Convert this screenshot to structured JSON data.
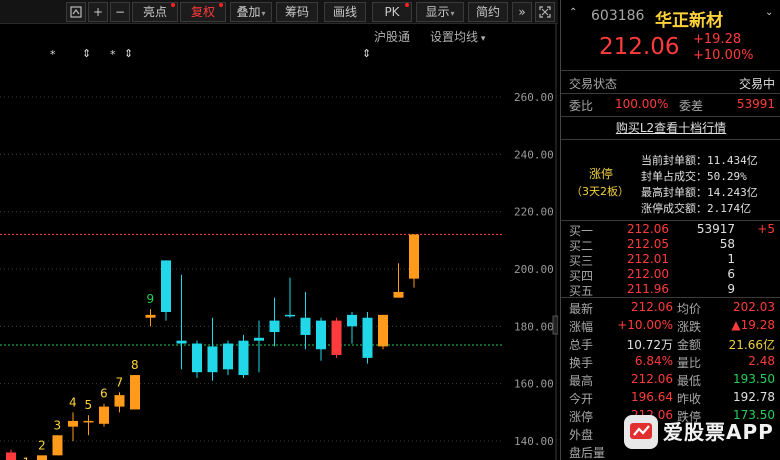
{
  "toolbar": {
    "items": [
      "亮点",
      "复权",
      "叠加",
      "筹码",
      "画线",
      "PK",
      "显示",
      "简约"
    ],
    "icons": [
      "resize-icon",
      "plus-icon",
      "minus-icon",
      "double-chevron-right-icon",
      "fullscreen-icon"
    ]
  },
  "chart_header": {
    "link1": "沪股通",
    "link2": "设置均线",
    "markers": [
      "*",
      "⇕",
      "*",
      "⇕",
      "⇕"
    ]
  },
  "chart_data": {
    "type": "candlestick",
    "y_ticks": [
      "260.00",
      "240.00",
      "220.00",
      "200.00",
      "180.00",
      "160.00",
      "140.00"
    ],
    "ylim": [
      128,
      270
    ],
    "reference_lines": [
      {
        "value": 212.06,
        "color": "#ff4040"
      },
      {
        "value": 173.5,
        "color": "#25d05a"
      }
    ],
    "candles": [
      {
        "o": 136,
        "c": 132,
        "h": 137,
        "l": 128,
        "up": false
      },
      {
        "o": 128,
        "c": 128,
        "h": 129,
        "l": 127,
        "up": true,
        "label": "1"
      },
      {
        "o": 128,
        "c": 135,
        "h": 135,
        "l": 128,
        "up": true,
        "label": "2"
      },
      {
        "o": 135,
        "c": 142,
        "h": 142,
        "l": 135,
        "up": true,
        "label": "3"
      },
      {
        "o": 145,
        "c": 147,
        "h": 150,
        "l": 140,
        "up": true,
        "label": "4"
      },
      {
        "o": 147,
        "c": 147,
        "h": 149,
        "l": 142,
        "up": true,
        "label": "5"
      },
      {
        "o": 146,
        "c": 152,
        "h": 153,
        "l": 145,
        "up": true,
        "label": "6"
      },
      {
        "o": 152,
        "c": 156,
        "h": 157,
        "l": 150,
        "up": true,
        "label": "7"
      },
      {
        "o": 151,
        "c": 163,
        "h": 163,
        "l": 151,
        "up": true,
        "label": "8"
      },
      {
        "o": 183,
        "c": 184,
        "h": 186,
        "l": 180,
        "up": true,
        "label": "9"
      },
      {
        "o": 203,
        "c": 185,
        "h": 203,
        "l": 182,
        "up": false
      },
      {
        "o": 175,
        "c": 174,
        "h": 198,
        "l": 165,
        "up": false
      },
      {
        "o": 174,
        "c": 164,
        "h": 175,
        "l": 162,
        "up": false
      },
      {
        "o": 173,
        "c": 164,
        "h": 183,
        "l": 161,
        "up": false
      },
      {
        "o": 174,
        "c": 165,
        "h": 175,
        "l": 163,
        "up": false
      },
      {
        "o": 175,
        "c": 163,
        "h": 177,
        "l": 162,
        "up": false
      },
      {
        "o": 176,
        "c": 175,
        "h": 182,
        "l": 164,
        "up": false
      },
      {
        "o": 182,
        "c": 178,
        "h": 190,
        "l": 173,
        "up": false
      },
      {
        "o": 184,
        "c": 184,
        "h": 197,
        "l": 183,
        "up": false
      },
      {
        "o": 183,
        "c": 177,
        "h": 192,
        "l": 172,
        "up": false
      },
      {
        "o": 182,
        "c": 172,
        "h": 183,
        "l": 168,
        "up": false
      },
      {
        "o": 170,
        "c": 182,
        "h": 183,
        "l": 169,
        "up": true
      },
      {
        "o": 184,
        "c": 180,
        "h": 185,
        "l": 174,
        "up": false
      },
      {
        "o": 183,
        "c": 169,
        "h": 185,
        "l": 167,
        "up": false
      },
      {
        "o": 173,
        "c": 184,
        "h": 184,
        "l": 172,
        "up": true
      },
      {
        "o": 190,
        "c": 192,
        "h": 202,
        "l": 190,
        "up": true
      },
      {
        "o": 196.64,
        "c": 212.06,
        "h": 212.06,
        "l": 193.5,
        "up": true
      }
    ]
  },
  "stock": {
    "code": "603186",
    "name": "华正新材",
    "price": "212.06",
    "change": "+19.28",
    "change_pct": "+10.00%"
  },
  "status": {
    "label": "交易状态",
    "value": "交易中"
  },
  "weibi": {
    "label1": "委比",
    "value1": "100.00%",
    "label2": "委差",
    "value2": "53991"
  },
  "l2_link": "购买L2查看十档行情",
  "limit_up": {
    "title": "涨停",
    "sub": "（3天2板）",
    "rows": [
      {
        "label": "当前封单额：",
        "value": "11.434亿"
      },
      {
        "label": "封单占成交：",
        "value": "50.29%"
      },
      {
        "label": "最高封单额：",
        "value": "14.243亿"
      },
      {
        "label": "涨停成交额：",
        "value": "2.174亿"
      }
    ]
  },
  "bids": [
    {
      "label": "买一",
      "price": "212.06",
      "vol": "53917",
      "diff": "+5"
    },
    {
      "label": "买二",
      "price": "212.05",
      "vol": "58",
      "diff": ""
    },
    {
      "label": "买三",
      "price": "212.01",
      "vol": "1",
      "diff": ""
    },
    {
      "label": "买四",
      "price": "212.00",
      "vol": "6",
      "diff": ""
    },
    {
      "label": "买五",
      "price": "211.96",
      "vol": "9",
      "diff": ""
    }
  ],
  "quote": [
    {
      "l1": "最新",
      "v1": "212.06",
      "l2": "均价",
      "v2": "202.03"
    },
    {
      "l1": "涨幅",
      "v1": "+10.00%",
      "l2": "涨跌",
      "v2": "▲19.28"
    },
    {
      "l1": "总手",
      "v1": "10.72万",
      "l2": "金额",
      "v2": "21.66亿"
    },
    {
      "l1": "换手",
      "v1": "6.84%",
      "l2": "量比",
      "v2": "2.48"
    },
    {
      "l1": "最高",
      "v1": "212.06",
      "l2": "最低",
      "v2": "193.50"
    },
    {
      "l1": "今开",
      "v1": "196.64",
      "l2": "昨收",
      "v2": "192.78"
    },
    {
      "l1": "涨停",
      "v1": "212.06",
      "l2": "跌停",
      "v2": "173.50"
    },
    {
      "l1": "外盘",
      "v1": "",
      "l2": "",
      "v2": ""
    },
    {
      "l1": "盘后量",
      "v1": "",
      "l2": "",
      "v2": ""
    }
  ],
  "watermark": {
    "text": "爱股票APP"
  }
}
